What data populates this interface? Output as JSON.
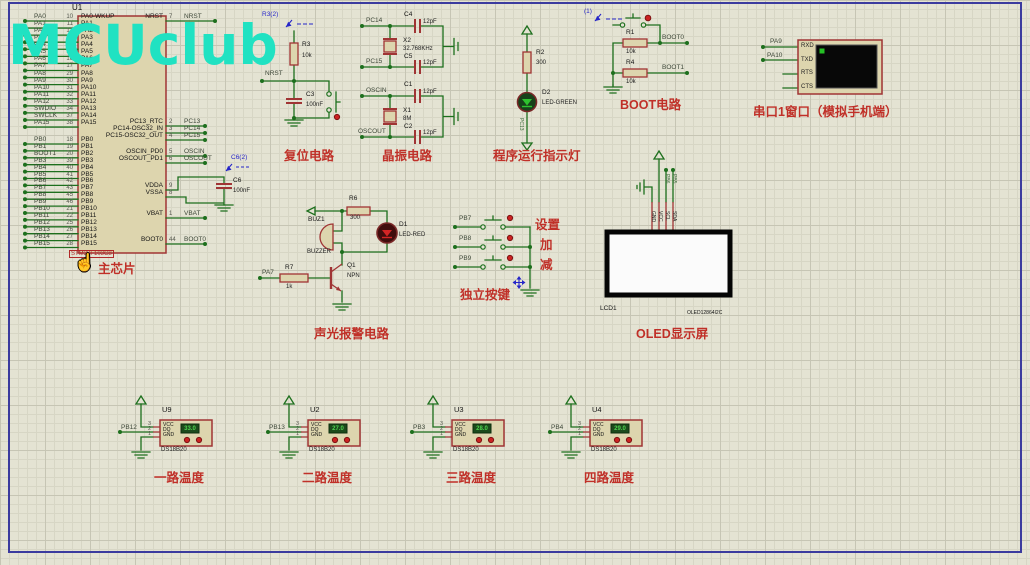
{
  "watermark": "MCUclub",
  "icons": {
    "cursor": "☝"
  },
  "chip": {
    "ref": "U1",
    "part": "STM32F103C8",
    "caption": "主芯片",
    "pins_left_a": [
      {
        "net": "PA0",
        "num": "10",
        "name": "PA0-WKUP"
      },
      {
        "net": "PA1",
        "num": "11",
        "name": "PA1"
      },
      {
        "net": "PA2",
        "num": "12",
        "name": "PA2"
      },
      {
        "net": "PA3",
        "num": "13",
        "name": "PA3"
      },
      {
        "net": "PA4",
        "num": "14",
        "name": "PA4"
      },
      {
        "net": "PA5",
        "num": "15",
        "name": "PA5"
      },
      {
        "net": "PA6",
        "num": "16",
        "name": "PA6"
      },
      {
        "net": "PA7",
        "num": "17",
        "name": "PA7"
      },
      {
        "net": "PA8",
        "num": "29",
        "name": "PA8"
      },
      {
        "net": "PA9",
        "num": "30",
        "name": "PA9"
      },
      {
        "net": "PA10",
        "num": "31",
        "name": "PA10"
      },
      {
        "net": "PA11",
        "num": "32",
        "name": "PA11"
      },
      {
        "net": "PA12",
        "num": "33",
        "name": "PA12"
      },
      {
        "net": "SWDIO",
        "num": "34",
        "name": "PA13"
      },
      {
        "net": "SWCLK",
        "num": "37",
        "name": "PA14"
      },
      {
        "net": "PA15",
        "num": "38",
        "name": "PA15"
      }
    ],
    "pins_left_b": [
      {
        "net": "PB0",
        "num": "18",
        "name": "PB0"
      },
      {
        "net": "PB1",
        "num": "19",
        "name": "PB1"
      },
      {
        "net": "BOOT1",
        "num": "20",
        "name": "PB2"
      },
      {
        "net": "PB3",
        "num": "39",
        "name": "PB3"
      },
      {
        "net": "PB4",
        "num": "40",
        "name": "PB4"
      },
      {
        "net": "PB5",
        "num": "41",
        "name": "PB5"
      },
      {
        "net": "PB6",
        "num": "42",
        "name": "PB6"
      },
      {
        "net": "PB7",
        "num": "43",
        "name": "PB7"
      },
      {
        "net": "PB8",
        "num": "45",
        "name": "PB8"
      },
      {
        "net": "PB9",
        "num": "46",
        "name": "PB9"
      },
      {
        "net": "PB10",
        "num": "21",
        "name": "PB10"
      },
      {
        "net": "PB11",
        "num": "22",
        "name": "PB11"
      },
      {
        "net": "PB12",
        "num": "25",
        "name": "PB12"
      },
      {
        "net": "PB13",
        "num": "26",
        "name": "PB13"
      },
      {
        "net": "PB14",
        "num": "27",
        "name": "PB14"
      },
      {
        "net": "PB15",
        "num": "28",
        "name": "PB15"
      }
    ],
    "pins_right": [
      {
        "num": "7",
        "name": "NRST",
        "net": "NRST"
      },
      {
        "num": "2",
        "name": "PC13_RTC",
        "net": "PC13"
      },
      {
        "num": "3",
        "name": "PC14-OSC32_IN",
        "net": "PC14"
      },
      {
        "num": "4",
        "name": "PC15-OSC32_OUT",
        "net": "PC15"
      },
      {
        "num": "5",
        "name": "OSCIN_PD0",
        "net": "OSCIN"
      },
      {
        "num": "6",
        "name": "OSCOUT_PD1",
        "net": "OSCOUT"
      },
      {
        "num": "9",
        "name": "VDDA",
        "net": ""
      },
      {
        "num": "8",
        "name": "VSSA",
        "net": ""
      },
      {
        "num": "1",
        "name": "VBAT",
        "net": "VBAT"
      },
      {
        "num": "44",
        "name": "BOOT0",
        "net": "BOOT0"
      }
    ]
  },
  "c6": {
    "ref": "C6",
    "val": "100nF",
    "probe": "C6(2)"
  },
  "reset": {
    "probe": "R3(2)",
    "r_ref": "R3",
    "r_val": "10k",
    "net": "NRST",
    "c_ref": "C3",
    "c_val": "100nF",
    "title": "复位电路"
  },
  "crystal": {
    "title": "晶振电路",
    "groups": [
      {
        "net_top": "PC14",
        "c_top_ref": "C4",
        "c_top_val": "12pF",
        "x_ref": "X2",
        "x_val": "32.768KHz",
        "net_bot": "PC15",
        "c_bot_ref": "C5",
        "c_bot_val": "12pF"
      },
      {
        "net_top": "OSCIN",
        "c_top_ref": "C1",
        "c_top_val": "12pF",
        "x_ref": "X1",
        "x_val": "8M",
        "net_bot": "OSCOUT",
        "c_bot_ref": "C2",
        "c_bot_val": "12pF"
      }
    ]
  },
  "indicator": {
    "r_ref": "R2",
    "r_val": "300",
    "d_ref": "D2",
    "d_val": "LED-GREEN",
    "net": "PC13",
    "title": "程序运行指示灯"
  },
  "boot": {
    "probe": "(1)",
    "r1_ref": "R1",
    "r1_val": "10k",
    "net1": "BOOT0",
    "r2_ref": "R4",
    "r2_val": "10k",
    "net2": "BOOT1",
    "title": "BOOT电路"
  },
  "serial": {
    "nets": [
      "PA9",
      "PA10"
    ],
    "pins": [
      "RXD",
      "TXD",
      "RTS",
      "CTS"
    ],
    "title": "串口1窗口（模拟手机端）"
  },
  "alarm": {
    "r6_ref": "R6",
    "r6_val": "300",
    "buz_ref": "BUZ1",
    "buz_val": "BUZZER",
    "d_ref": "D1",
    "d_val": "LED-RED",
    "q_ref": "Q1",
    "q_val": "NPN",
    "r7_ref": "R7",
    "r7_val": "1k",
    "net": "PA7",
    "title": "声光报警电路"
  },
  "buttons": {
    "title": "独立按键",
    "rows": [
      {
        "net": "PB7",
        "label": "设置"
      },
      {
        "net": "PB8",
        "label": "加"
      },
      {
        "net": "PB9",
        "label": "减"
      }
    ]
  },
  "oled": {
    "ref": "LCD1",
    "part": "OLED12864I2C",
    "title": "OLED显示屏",
    "pins": [
      "GND",
      "VCC",
      "SCL",
      "SDA"
    ],
    "nets": [
      "PB6",
      "PB5"
    ]
  },
  "sensors": {
    "part": "DS18B20",
    "pin_names": [
      "VCC",
      "DQ",
      "GND"
    ],
    "pin_nums": [
      "3",
      "2",
      "1"
    ],
    "items": [
      {
        "ref": "U9",
        "net": "PB12",
        "value": "33.0",
        "title": "一路温度"
      },
      {
        "ref": "U2",
        "net": "PB13",
        "value": "27.0",
        "title": "二路温度"
      },
      {
        "ref": "U3",
        "net": "PB3",
        "value": "28.0",
        "title": "三路温度"
      },
      {
        "ref": "U4",
        "net": "PB4",
        "value": "29.0",
        "title": "四路温度"
      }
    ]
  }
}
